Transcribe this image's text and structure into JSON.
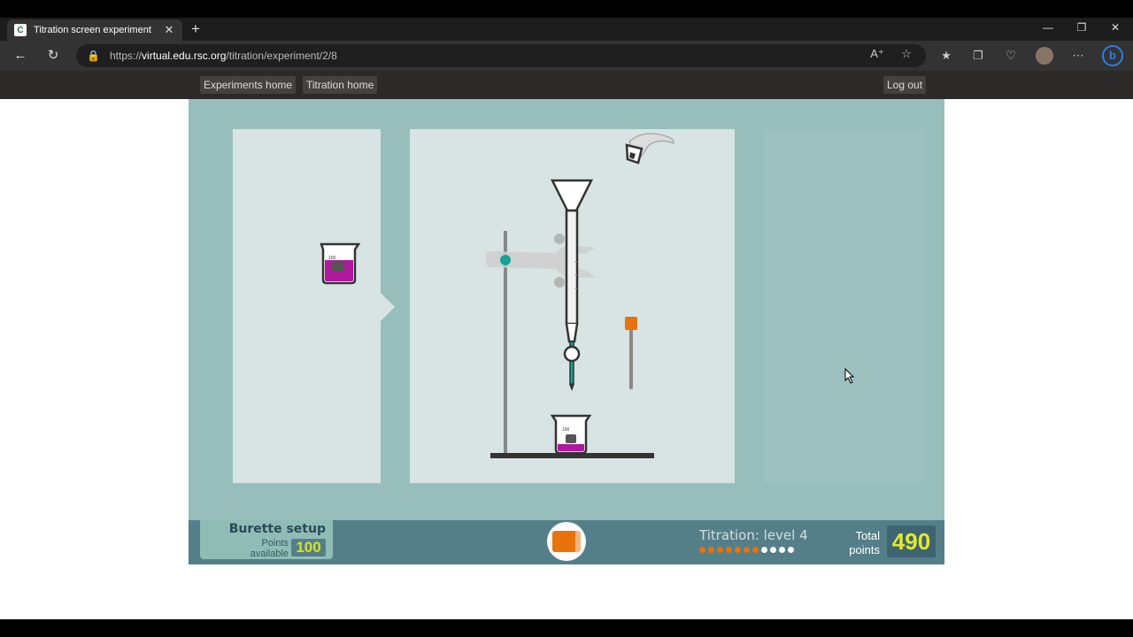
{
  "browser": {
    "tab_title": "Titration screen experiment",
    "favicon_letter": "C",
    "tab_close": "✕",
    "new_tab": "+",
    "url_prefix": "https://",
    "url_host": "virtual.edu.rsc.org",
    "url_path": "/titration/experiment/2/8",
    "window_controls": {
      "minimize": "—",
      "restore": "❐",
      "close": "✕"
    }
  },
  "site_nav": {
    "experiments_home": "Experiments home",
    "titration_home": "Titration home",
    "log_out": "Log out"
  },
  "apparatus": {
    "beaker_label": "100",
    "beaker_unit": "cm³",
    "indicator_color": "#b0189e",
    "burette_tap_color": "#16a394",
    "stopper_color": "#e8720c"
  },
  "status_bar": {
    "stage_title": "Burette setup",
    "points_label_1": "Points",
    "points_label_2": "available",
    "points_available": "100",
    "level_text": "Titration: level 4",
    "level_progress": {
      "completed": 7,
      "total": 11
    },
    "total_label_1": "Total",
    "total_label_2": "points",
    "total_points": "490"
  },
  "colors": {
    "sim_background": "#97bebb",
    "panel": "#d7e4e3",
    "status_bar": "#547f88",
    "points_yellow": "#d4e22a",
    "progress_done": "#e8720c",
    "progress_todo": "#ffffff"
  }
}
